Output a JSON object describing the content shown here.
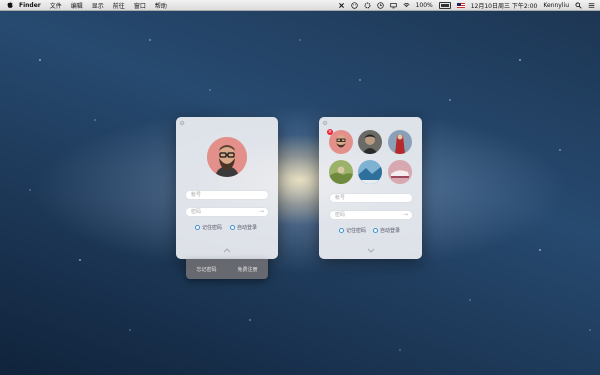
{
  "menubar": {
    "app_name": "Finder",
    "menus": [
      "文件",
      "编辑",
      "显示",
      "前往",
      "窗口",
      "帮助"
    ],
    "battery": "100%",
    "datetime": "12月10日周三 下午2:00",
    "user": "Kennyliu",
    "status_icons": [
      "scissors-icon",
      "face-icon",
      "settings-icon",
      "clock-icon",
      "display-icon",
      "wifi-icon",
      "battery-icon",
      "us-flag-icon",
      "search-icon",
      "list-icon"
    ]
  },
  "left_panel": {
    "account_placeholder": "帐号",
    "password_placeholder": "密码",
    "remember_label": "记住密码",
    "autologin_label": "自动登录",
    "drawer": {
      "forgot_label": "忘记密码",
      "register_label": "免费注册"
    }
  },
  "right_panel": {
    "account_placeholder": "帐号",
    "password_placeholder": "密码",
    "remember_label": "记住密码",
    "autologin_label": "自动登录",
    "avatars": [
      "avatar-bearded-man",
      "avatar-dark-figure",
      "avatar-red-figure",
      "avatar-green-hills",
      "avatar-blue-landscape",
      "avatar-pink-shoes"
    ],
    "badge": "×"
  },
  "colors": {
    "accent": "#3a8fd8",
    "badge": "#e22233",
    "panel": "#eceef2"
  }
}
